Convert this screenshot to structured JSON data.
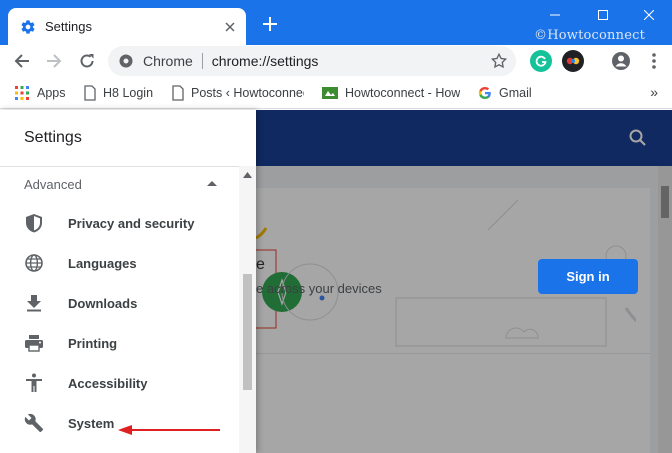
{
  "window": {
    "tab_title": "Settings",
    "watermark": "©Howtoconnect"
  },
  "toolbar": {
    "site_label": "Chrome",
    "url": "chrome://settings"
  },
  "bookmarks": [
    {
      "label": "Apps",
      "icon": "apps-grid-icon"
    },
    {
      "label": "H8 Login",
      "icon": "page-icon"
    },
    {
      "label": "Posts ‹ Howtoconnec",
      "icon": "page-icon"
    },
    {
      "label": "Howtoconnect - How",
      "icon": "howtoconnect-favicon-icon"
    },
    {
      "label": "Gmail",
      "icon": "google-icon"
    }
  ],
  "bookmarks_more": "»",
  "drawer": {
    "title": "Settings",
    "section": "Advanced",
    "items": [
      {
        "label": "Privacy and security",
        "icon": "shield-icon"
      },
      {
        "label": "Languages",
        "icon": "globe-icon"
      },
      {
        "label": "Downloads",
        "icon": "download-icon"
      },
      {
        "label": "Printing",
        "icon": "printer-icon"
      },
      {
        "label": "Accessibility",
        "icon": "accessibility-icon"
      },
      {
        "label": "System",
        "icon": "wrench-icon"
      }
    ]
  },
  "page": {
    "signin_title": "e",
    "signin_subtitle": "e across your devices",
    "signin_button": "Sign in"
  },
  "colors": {
    "accent": "#1a73e8",
    "header": "#1a3f94",
    "arrow": "#e02020"
  }
}
